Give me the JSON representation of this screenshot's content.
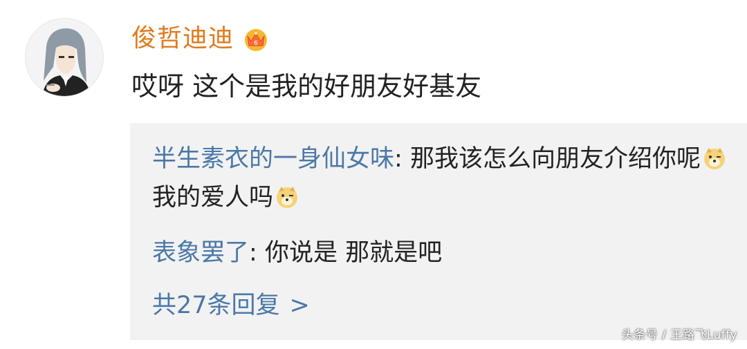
{
  "post": {
    "username": "俊哲迪迪",
    "comment": "哎呀 这个是我的好朋友好基友"
  },
  "replies": [
    {
      "name": "半生素衣的一身仙女味",
      "sep": ": ",
      "text_part1": "那我该怎么向朋友介绍你呢",
      "text_part2": "我的爱人吗"
    },
    {
      "name": "表象罢了",
      "sep": ": ",
      "text": "你说是 那就是吧"
    }
  ],
  "more_replies": {
    "label": "共27条回复",
    "chevron": ">"
  },
  "watermark": "头条号 / 王路飞Luffy",
  "icons": {
    "avatar": "anime-avatar",
    "badge": "crown-badge-icon",
    "emoji": "doge-emoji-icon"
  },
  "colors": {
    "username": "#e07a1c",
    "reply_name": "#4a78a8",
    "reply_bg": "#f2f2f2"
  }
}
